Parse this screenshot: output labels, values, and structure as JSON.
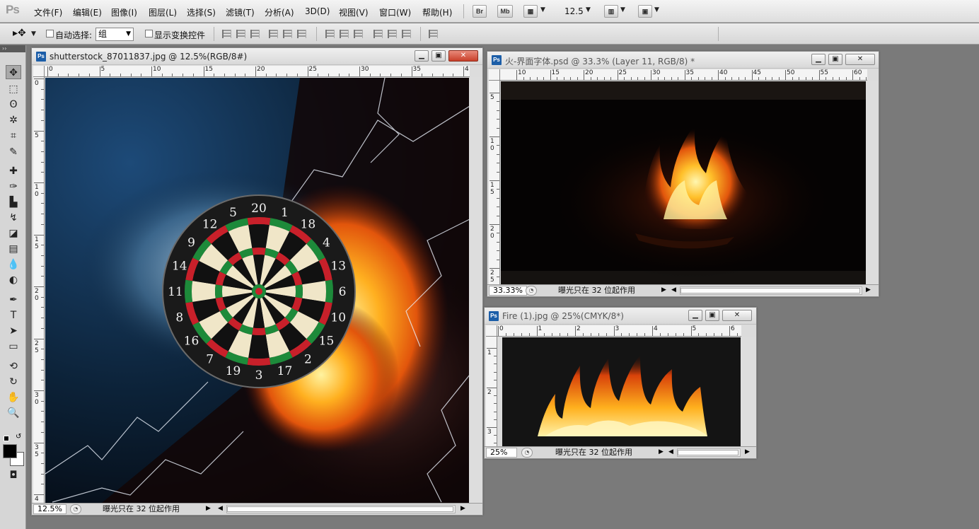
{
  "app": {
    "logo": "Ps"
  },
  "menu": {
    "items": [
      "文件(F)",
      "编辑(E)",
      "图像(I)",
      "图层(L)",
      "选择(S)",
      "滤镜(T)",
      "分析(A)",
      "3D(D)",
      "视图(V)",
      "窗口(W)",
      "帮助(H)"
    ],
    "bridge_label": "Br",
    "minibridge_label": "Mb",
    "zoom_value": "12.5"
  },
  "options": {
    "auto_select_label": "自动选择:",
    "auto_select_value": "组",
    "show_transform_label": "显示变换控件"
  },
  "windows": {
    "dartboard": {
      "title": "shutterstock_87011837.jpg @ 12.5%(RGB/8#)",
      "zoom": "12.5%",
      "status": "曝光只在 32 位起作用",
      "ruler_h": [
        "0",
        "5",
        "10",
        "15",
        "20",
        "25",
        "30",
        "35",
        "4"
      ],
      "ruler_v": [
        "0",
        "5",
        "1 0",
        "1 5",
        "2 0",
        "2 5",
        "3 0",
        "3 5",
        "4"
      ],
      "board_numbers": [
        "20",
        "1",
        "18",
        "4",
        "13",
        "6",
        "10",
        "15",
        "2",
        "17",
        "3",
        "19",
        "7",
        "16",
        "8",
        "11",
        "14",
        "9",
        "12",
        "5"
      ]
    },
    "fire_psd": {
      "title": "火-界面字体.psd @ 33.3% (Layer 11, RGB/8) *",
      "zoom": "33.33%",
      "status": "曝光只在 32 位起作用",
      "ruler_h": [
        "10",
        "15",
        "20",
        "25",
        "30",
        "35",
        "40",
        "45",
        "50",
        "55",
        "60"
      ],
      "ruler_v": [
        "5",
        "1 0",
        "1 5",
        "2 0",
        "2 5"
      ]
    },
    "fire_jpg": {
      "title": "Fire (1).jpg @ 25%(CMYK/8*)",
      "zoom": "25%",
      "status": "曝光只在 32 位起作用",
      "ruler_h": [
        "0",
        "1",
        "2",
        "3",
        "4",
        "5",
        "6"
      ],
      "ruler_v": [
        "1",
        "2",
        "3"
      ]
    }
  },
  "colors": {
    "accent": "#1c5ea8",
    "close": "#c9402a",
    "background": "#7a7a7a"
  }
}
